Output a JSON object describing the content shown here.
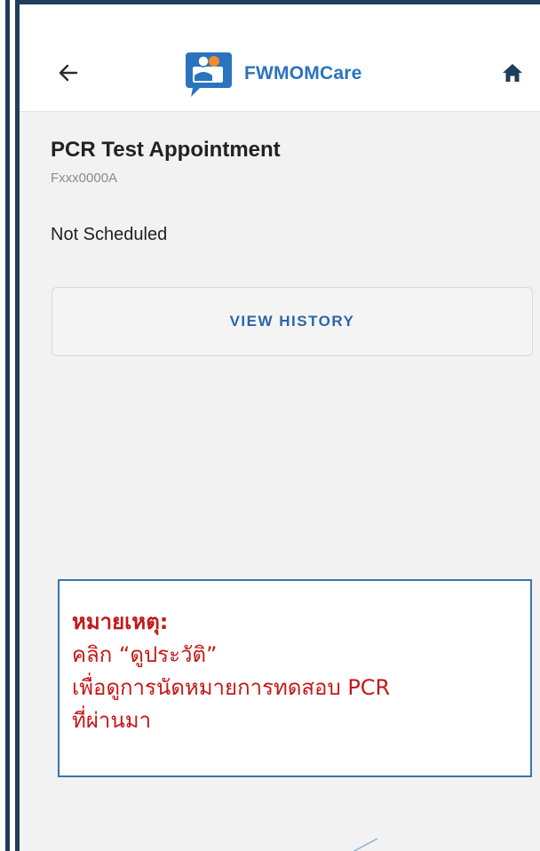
{
  "header": {
    "app_name": "FWMOMCare",
    "back_icon": "arrow-left-icon",
    "home_icon": "home-icon",
    "logo_icon": "fwmomcare-logo-icon",
    "accent_color": "#2a73bd"
  },
  "main": {
    "title": "PCR Test Appointment",
    "worker_id": "Fxxx0000A",
    "status": "Not Scheduled",
    "view_history_label": "VIEW HISTORY"
  },
  "note": {
    "heading": "หมายเหตุ:",
    "line1": "คลิก “ดูประวัติ”",
    "line2": "เพื่อดูการนัดหมายการทดสอบ PCR",
    "line3": "ที่ผ่านมา",
    "text_color": "#c41818",
    "border_color": "#3a74b0"
  },
  "frame_color": "#1f3d5c"
}
